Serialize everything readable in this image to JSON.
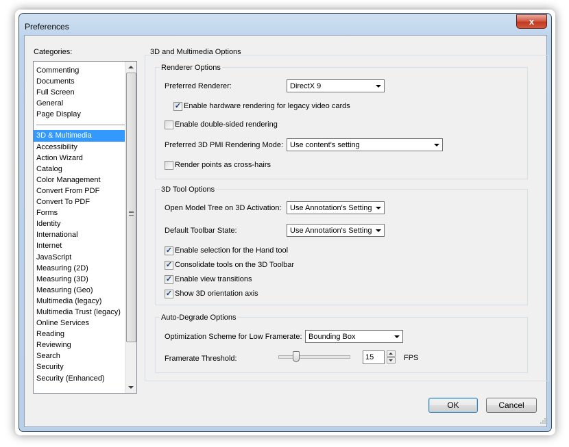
{
  "window": {
    "title": "Preferences",
    "close_symbol": "x"
  },
  "categories": {
    "label": "Categories:",
    "pinned": [
      "Commenting",
      "Documents",
      "Full Screen",
      "General",
      "Page Display"
    ],
    "items": [
      "3D & Multimedia",
      "Accessibility",
      "Action Wizard",
      "Catalog",
      "Color Management",
      "Convert From PDF",
      "Convert To PDF",
      "Forms",
      "Identity",
      "International",
      "Internet",
      "JavaScript",
      "Measuring (2D)",
      "Measuring (3D)",
      "Measuring (Geo)",
      "Multimedia (legacy)",
      "Multimedia Trust (legacy)",
      "Online Services",
      "Reading",
      "Reviewing",
      "Search",
      "Security",
      "Security (Enhanced)"
    ],
    "selected": "3D & Multimedia"
  },
  "panel": {
    "title": "3D and Multimedia Options",
    "renderer": {
      "group_title": "Renderer Options",
      "preferred_renderer_label": "Preferred Renderer:",
      "preferred_renderer_value": "DirectX 9",
      "hw_legacy_label": "Enable hardware rendering for legacy video cards",
      "hw_legacy_checked": true,
      "double_sided_label": "Enable double-sided rendering",
      "double_sided_checked": false,
      "pmi_label": "Preferred 3D PMI Rendering Mode:",
      "pmi_value": "Use content's setting",
      "crosshairs_label": "Render points as cross-hairs",
      "crosshairs_checked": false
    },
    "tool": {
      "group_title": "3D Tool Options",
      "model_tree_label": "Open Model Tree on 3D Activation:",
      "model_tree_value": "Use Annotation's Setting",
      "toolbar_state_label": "Default Toolbar State:",
      "toolbar_state_value": "Use Annotation's Setting",
      "hand_tool_label": "Enable selection for the Hand tool",
      "hand_tool_checked": true,
      "consolidate_label": "Consolidate tools on the 3D Toolbar",
      "consolidate_checked": true,
      "view_transitions_label": "Enable view transitions",
      "view_transitions_checked": true,
      "orientation_axis_label": "Show 3D orientation axis",
      "orientation_axis_checked": true
    },
    "degrade": {
      "group_title": "Auto-Degrade Options",
      "scheme_label": "Optimization Scheme for Low Framerate:",
      "scheme_value": "Bounding Box",
      "threshold_label": "Framerate Threshold:",
      "threshold_value": "15",
      "threshold_unit": "FPS"
    }
  },
  "buttons": {
    "ok": "OK",
    "cancel": "Cancel"
  }
}
